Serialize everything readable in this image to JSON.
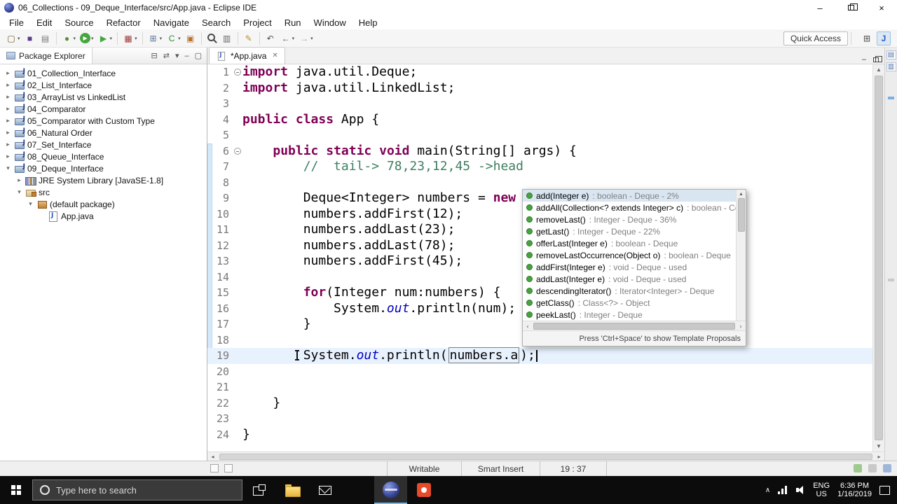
{
  "titlebar": {
    "title": "06_Collections - 09_Deque_Interface/src/App.java - Eclipse IDE",
    "minimize_glyph": "–",
    "close_glyph": "×"
  },
  "menubar": {
    "items": [
      "File",
      "Edit",
      "Source",
      "Refactor",
      "Navigate",
      "Search",
      "Project",
      "Run",
      "Window",
      "Help"
    ]
  },
  "toolbar": {
    "quick_access_label": "Quick Access",
    "icons": [
      {
        "name": "new-wizard",
        "glyph": "▢",
        "color": "#6b5b1e",
        "dd": true
      },
      {
        "name": "save",
        "glyph": "■",
        "color": "#5b3a8e"
      },
      {
        "name": "print",
        "glyph": "▤",
        "color": "#777777"
      },
      {
        "sep": true
      },
      {
        "name": "debug",
        "glyph": "●",
        "color": "#5a8f3c",
        "dd": true
      },
      {
        "name": "run",
        "glyph": "▶",
        "color": "#ffffff",
        "bg": "#44a63d",
        "round": true,
        "dd": true
      },
      {
        "name": "run-external-tools",
        "glyph": "▶",
        "color": "#44a63d",
        "dd": true
      },
      {
        "sep": true
      },
      {
        "name": "coverage",
        "glyph": "▦",
        "color": "#a23b3b",
        "dd": true
      },
      {
        "sep": true
      },
      {
        "name": "new-java-project",
        "glyph": "⊞",
        "color": "#5d7699",
        "dd": true
      },
      {
        "name": "new-java-class",
        "glyph": "C",
        "color": "#2e8b2e",
        "dd": true
      },
      {
        "name": "new-package",
        "glyph": "▣",
        "color": "#b5742c"
      },
      {
        "sep": true
      },
      {
        "name": "search",
        "shape": "magnifier"
      },
      {
        "name": "open-type",
        "glyph": "▥",
        "color": "#666666"
      },
      {
        "sep": true
      },
      {
        "name": "mark-occurrences",
        "glyph": "✎",
        "color": "#b8912a"
      },
      {
        "sep": true
      },
      {
        "name": "last-edit-location",
        "glyph": "↶",
        "color": "#555555"
      },
      {
        "name": "back",
        "glyph": "←",
        "color": "#555555",
        "dd": true
      },
      {
        "name": "forward",
        "glyph": "→",
        "color": "#aaaaaa",
        "dd": true
      }
    ],
    "perspectives": [
      {
        "name": "open-perspective",
        "glyph": "⊞",
        "color": "#666666"
      },
      {
        "name": "java-perspective",
        "glyph": "J",
        "color": "#2456c9",
        "active": true
      }
    ]
  },
  "package_explorer": {
    "tab_title": "Package Explorer",
    "header_icons": [
      {
        "name": "collapse-all",
        "glyph": "⊟"
      },
      {
        "name": "link-with-editor",
        "glyph": "⇄"
      },
      {
        "name": "view-menu",
        "glyph": "▾"
      },
      {
        "name": "minimize-view",
        "glyph": "–"
      },
      {
        "name": "maximize-view",
        "glyph": "▢"
      }
    ],
    "tree": [
      {
        "depth": 0,
        "arrow": "c",
        "icon": "project",
        "label": "01_Collection_Interface"
      },
      {
        "depth": 0,
        "arrow": "c",
        "icon": "project",
        "label": "02_List_Interface"
      },
      {
        "depth": 0,
        "arrow": "c",
        "icon": "project",
        "label": "03_ArrayList vs LinkedList"
      },
      {
        "depth": 0,
        "arrow": "c",
        "icon": "project",
        "label": "04_Comparator"
      },
      {
        "depth": 0,
        "arrow": "c",
        "icon": "project",
        "label": "05_Comparator with Custom Type"
      },
      {
        "depth": 0,
        "arrow": "c",
        "icon": "project",
        "label": "06_Natural Order"
      },
      {
        "depth": 0,
        "arrow": "c",
        "icon": "project",
        "label": "07_Set_Interface"
      },
      {
        "depth": 0,
        "arrow": "c",
        "icon": "project",
        "label": "08_Queue_Interface"
      },
      {
        "depth": 0,
        "arrow": "e",
        "icon": "project",
        "label": "09_Deque_Interface"
      },
      {
        "depth": 1,
        "arrow": "c",
        "icon": "library",
        "label": "JRE System Library [JavaSE-1.8]"
      },
      {
        "depth": 1,
        "arrow": "e",
        "icon": "srcfolder",
        "label": "src"
      },
      {
        "depth": 2,
        "arrow": "e",
        "icon": "package",
        "label": "(default package)"
      },
      {
        "depth": 3,
        "arrow": "n",
        "icon": "jfile",
        "label": "App.java"
      }
    ]
  },
  "editor": {
    "tab_label": "*App.java",
    "tab_close_glyph": "✕",
    "lines": [
      {
        "n": 1,
        "fold": true,
        "tokens": [
          [
            "kw",
            "import"
          ],
          [
            "pl",
            " java.util.Deque;"
          ]
        ]
      },
      {
        "n": 2,
        "tokens": [
          [
            "kw",
            "import"
          ],
          [
            "pl",
            " java.util.LinkedList;"
          ]
        ]
      },
      {
        "n": 3,
        "tokens": []
      },
      {
        "n": 4,
        "tokens": [
          [
            "kw",
            "public"
          ],
          [
            "pl",
            " "
          ],
          [
            "kw",
            "class"
          ],
          [
            "pl",
            " App {"
          ]
        ]
      },
      {
        "n": 5,
        "tokens": []
      },
      {
        "n": 6,
        "fold": true,
        "tokens": [
          [
            "pl",
            "    "
          ],
          [
            "kw",
            "public"
          ],
          [
            "pl",
            " "
          ],
          [
            "kw",
            "static"
          ],
          [
            "pl",
            " "
          ],
          [
            "kw",
            "void"
          ],
          [
            "pl",
            " main(String[] args) {"
          ]
        ]
      },
      {
        "n": 7,
        "tokens": [
          [
            "pl",
            "        "
          ],
          [
            "com",
            "//  tail-> 78,23,12,45 ->head"
          ]
        ]
      },
      {
        "n": 8,
        "tokens": []
      },
      {
        "n": 9,
        "tokens": [
          [
            "pl",
            "        Deque<Integer> numbers = "
          ],
          [
            "kw",
            "new"
          ]
        ]
      },
      {
        "n": 10,
        "tokens": [
          [
            "pl",
            "        numbers.addFirst(12);"
          ]
        ]
      },
      {
        "n": 11,
        "tokens": [
          [
            "pl",
            "        numbers.addLast(23);"
          ]
        ]
      },
      {
        "n": 12,
        "tokens": [
          [
            "pl",
            "        numbers.addLast(78);"
          ]
        ]
      },
      {
        "n": 13,
        "tokens": [
          [
            "pl",
            "        numbers.addFirst(45);"
          ]
        ]
      },
      {
        "n": 14,
        "tokens": []
      },
      {
        "n": 15,
        "tokens": [
          [
            "pl",
            "        "
          ],
          [
            "kw",
            "for"
          ],
          [
            "pl",
            "(Integer num:numbers) {"
          ]
        ]
      },
      {
        "n": 16,
        "tokens": [
          [
            "pl",
            "            System."
          ],
          [
            "fld",
            "out"
          ],
          [
            "pl",
            ".println(num);"
          ]
        ]
      },
      {
        "n": 17,
        "tokens": [
          [
            "pl",
            "        }"
          ]
        ]
      },
      {
        "n": 18,
        "tokens": []
      },
      {
        "n": 19,
        "current": true,
        "tokens": [
          [
            "pl",
            "        System."
          ],
          [
            "fld",
            "out"
          ],
          [
            "pl",
            ".println("
          ],
          [
            "box",
            "numbers.a"
          ],
          [
            "pl",
            ");"
          ],
          [
            "caret",
            ""
          ]
        ]
      },
      {
        "n": 20,
        "tokens": []
      },
      {
        "n": 21,
        "tokens": []
      },
      {
        "n": 22,
        "tokens": [
          [
            "pl",
            "    }"
          ]
        ]
      },
      {
        "n": 23,
        "tokens": []
      },
      {
        "n": 24,
        "tokens": [
          [
            "pl",
            "}"
          ]
        ]
      }
    ]
  },
  "autocomplete": {
    "items": [
      {
        "label": "add(Integer e)",
        "detail": " : boolean - Deque - 2%",
        "selected": true
      },
      {
        "label": "addAll(Collection<? extends Integer> c)",
        "detail": " : boolean - Colle"
      },
      {
        "label": "removeLast()",
        "detail": " : Integer - Deque - 36%"
      },
      {
        "label": "getLast()",
        "detail": " : Integer - Deque - 22%"
      },
      {
        "label": "offerLast(Integer e)",
        "detail": " : boolean - Deque"
      },
      {
        "label": "removeLastOccurrence(Object o)",
        "detail": " : boolean - Deque"
      },
      {
        "label": "addFirst(Integer e)",
        "detail": " : void - Deque - used"
      },
      {
        "label": "addLast(Integer e)",
        "detail": " : void - Deque - used"
      },
      {
        "label": "descendingIterator()",
        "detail": " : Iterator<Integer> - Deque"
      },
      {
        "label": "getClass()",
        "detail": " : Class<?> - Object"
      },
      {
        "label": "peekLast()",
        "detail": " : Integer - Deque"
      }
    ],
    "footer": "Press 'Ctrl+Space' to show Template Proposals"
  },
  "statusbar": {
    "writable": "Writable",
    "insert_mode": "Smart Insert",
    "position": "19 : 37"
  },
  "taskbar": {
    "search_placeholder": "Type here to search",
    "apps": [
      {
        "name": "task-view"
      },
      {
        "name": "file-explorer"
      },
      {
        "name": "mail"
      },
      {
        "name": "edge"
      },
      {
        "name": "eclipse",
        "active": true
      },
      {
        "name": "red-app"
      }
    ],
    "tray": {
      "lang": "ENG",
      "region": "US",
      "time": "6:36 PM",
      "date": "1/16/2019"
    }
  }
}
